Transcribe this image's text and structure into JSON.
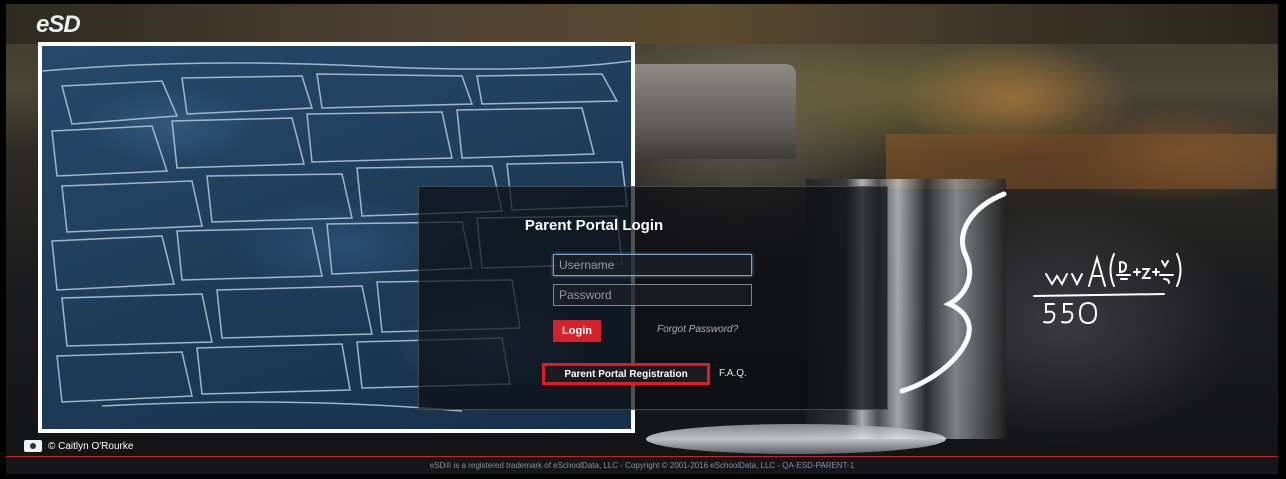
{
  "app": {
    "brand": "eSD"
  },
  "login": {
    "title": "Parent Portal Login",
    "username_placeholder": "Username",
    "password_placeholder": "Password",
    "login_label": "Login",
    "forgot_label": "Forgot Password?",
    "registration_label": "Parent Portal Registration",
    "faq_label": "F.A.Q."
  },
  "photo": {
    "credit": "© Caitlyn O'Rourke"
  },
  "footer": {
    "text": "eSD® is a registered trademark of eSchoolData, LLC - Copyright © 2001-2016 eSchoolData, LLC - QA-ESD-PARENT-1"
  },
  "colors": {
    "accent_red": "#d2222a",
    "highlight_border": "#e01b24",
    "wall_overlay": "#1f3f5d",
    "overlay_border": "#ffffff"
  },
  "icons": [
    "camera-icon"
  ]
}
